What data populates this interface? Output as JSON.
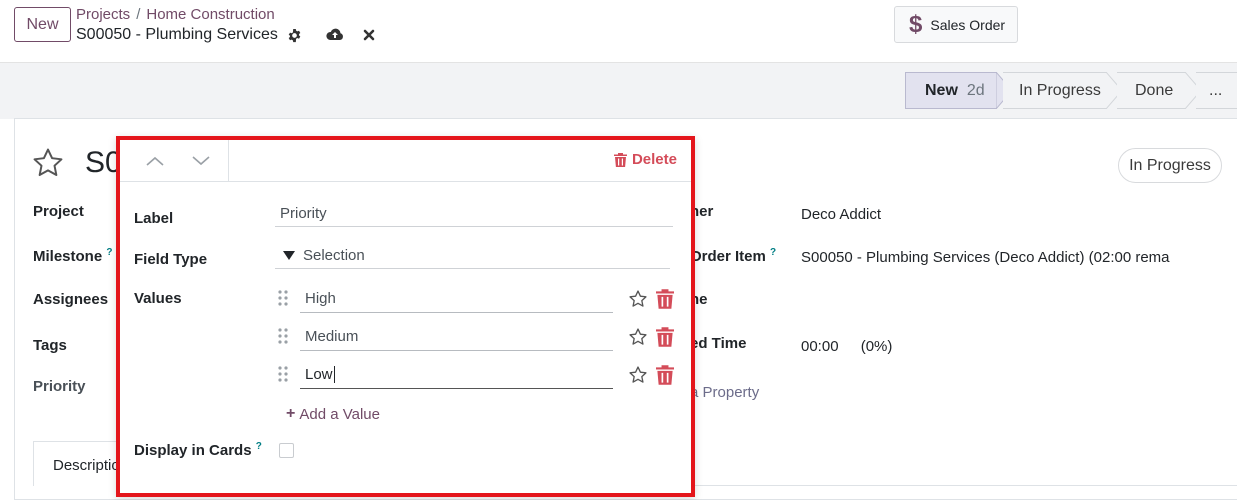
{
  "topbar": {
    "new_label": "New",
    "breadcrumb": [
      "Projects",
      "Home Construction"
    ],
    "breadcrumb_sep": "/",
    "record_title": "S00050 - Plumbing Services",
    "sales_order_label": "Sales Order"
  },
  "statusbar": {
    "stages": [
      {
        "label": "New",
        "duration": "2d",
        "active": true
      },
      {
        "label": "In Progress"
      },
      {
        "label": "Done"
      },
      {
        "label": "..."
      }
    ]
  },
  "form": {
    "title_partial": "S0",
    "left_labels": {
      "project": "Project",
      "milestone": "Milestone",
      "assignees": "Assignees",
      "tags": "Tags",
      "priority": "Priority"
    },
    "help_mark": "?",
    "right": {
      "customer_label_partial": "ner",
      "customer_value": "Deco Addict",
      "sales_order_item_label_partial": "Order Item",
      "sales_order_item_value": "S00050 - Plumbing Services (Deco Addict) (02:00 rema",
      "deadline_label_partial": "ne",
      "allocated_label_partial": "ed Time",
      "allocated_time": "00:00",
      "allocated_pct": "(0%)",
      "add_property_partial": "a Property"
    },
    "state_badge": "In Progress",
    "tab_description_partial": "Descriptio"
  },
  "popover": {
    "delete_label": "Delete",
    "label_label": "Label",
    "label_value": "Priority",
    "field_type_label": "Field Type",
    "field_type_value": "Selection",
    "values_label": "Values",
    "values": [
      "High",
      "Medium",
      "Low"
    ],
    "add_value_label": "Add a Value",
    "display_in_cards_label": "Display in Cards",
    "display_in_cards_checked": false
  },
  "colors": {
    "brand": "#714b67",
    "danger": "#d44c59",
    "highlight_border": "#e4151b",
    "help": "#017e84"
  }
}
